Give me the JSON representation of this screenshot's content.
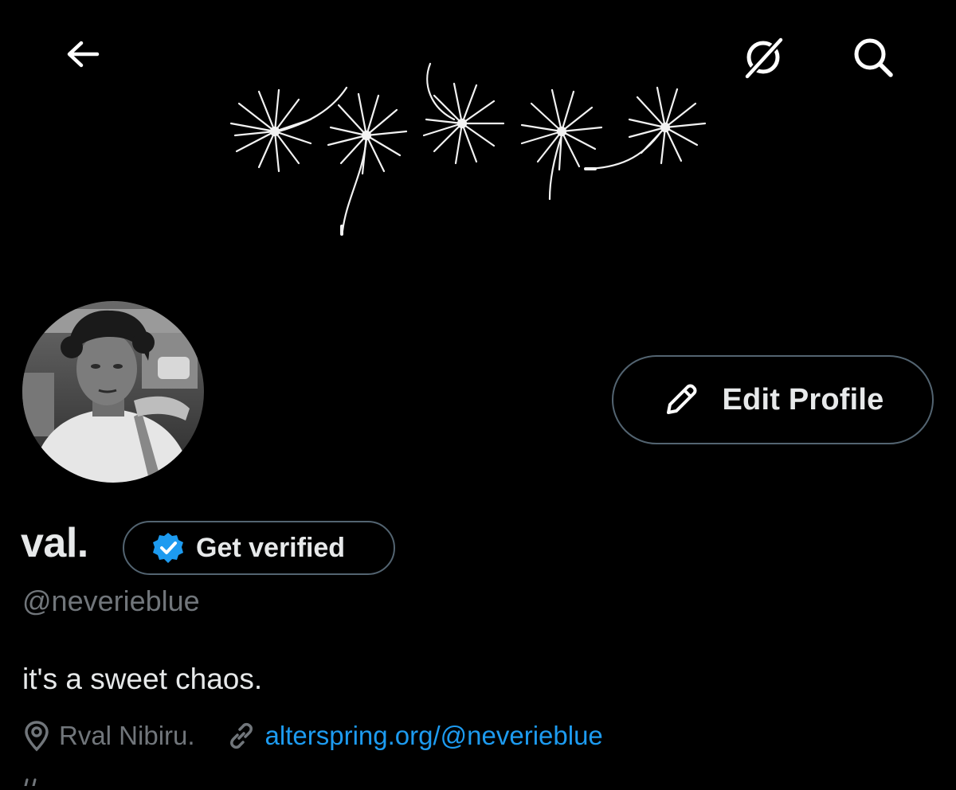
{
  "header": {
    "back_icon": "arrow-left-icon",
    "grok_icon": "grok-icon",
    "search_icon": "search-icon"
  },
  "banner": {
    "description_icon": "dandelion-art"
  },
  "profile": {
    "display_name": "val.",
    "handle": "@neverieblue",
    "bio": "it's a sweet chaos.",
    "location": "Rval Nibiru.",
    "website": "alterspring.org/@neverieblue"
  },
  "actions": {
    "edit_profile_label": "Edit Profile",
    "get_verified_label": "Get verified"
  },
  "colors": {
    "background": "#000000",
    "text_primary": "#e7e9ea",
    "text_secondary": "#71767b",
    "accent_blue": "#1d9bf0",
    "border": "#536471"
  }
}
